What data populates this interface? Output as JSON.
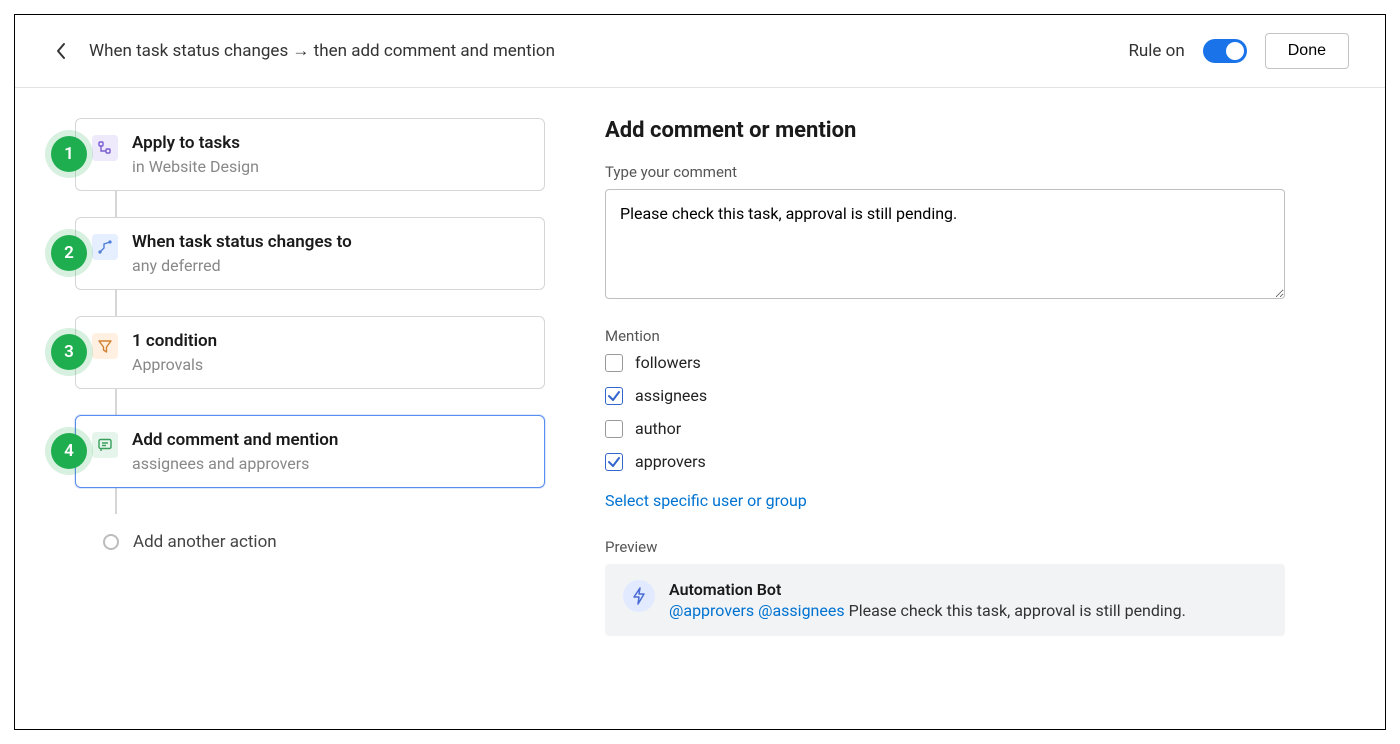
{
  "header": {
    "title": "When task status changes → then add comment and mention",
    "rule_label": "Rule on",
    "rule_enabled": true,
    "done_label": "Done"
  },
  "steps": [
    {
      "num": "1",
      "title": "Apply to tasks",
      "sub": "in Website Design",
      "icon": "tree-icon",
      "iconClass": "icon-purple",
      "selected": false
    },
    {
      "num": "2",
      "title": "When task status changes to",
      "sub": "any deferred",
      "icon": "branch-icon",
      "iconClass": "icon-blue",
      "selected": false
    },
    {
      "num": "3",
      "title": "1 condition",
      "sub": "Approvals",
      "icon": "filter-icon",
      "iconClass": "icon-orange",
      "selected": false
    },
    {
      "num": "4",
      "title": "Add comment and mention",
      "sub": "assignees and approvers",
      "icon": "comment-icon",
      "iconClass": "icon-green",
      "selected": true
    }
  ],
  "add_action_label": "Add another action",
  "right": {
    "title": "Add comment or mention",
    "comment_label": "Type your comment",
    "comment_value": "Please check this task, approval is still pending.",
    "mention_label": "Mention",
    "mention_items": [
      {
        "label": "followers",
        "checked": false
      },
      {
        "label": "assignees",
        "checked": true
      },
      {
        "label": "author",
        "checked": false
      },
      {
        "label": "approvers",
        "checked": true
      }
    ],
    "select_user_label": "Select specific user or group",
    "preview_label": "Preview",
    "preview": {
      "bot_name": "Automation Bot",
      "mentions_text": "@approvers @assignees",
      "body": "Please check this task, approval is still pending."
    }
  }
}
